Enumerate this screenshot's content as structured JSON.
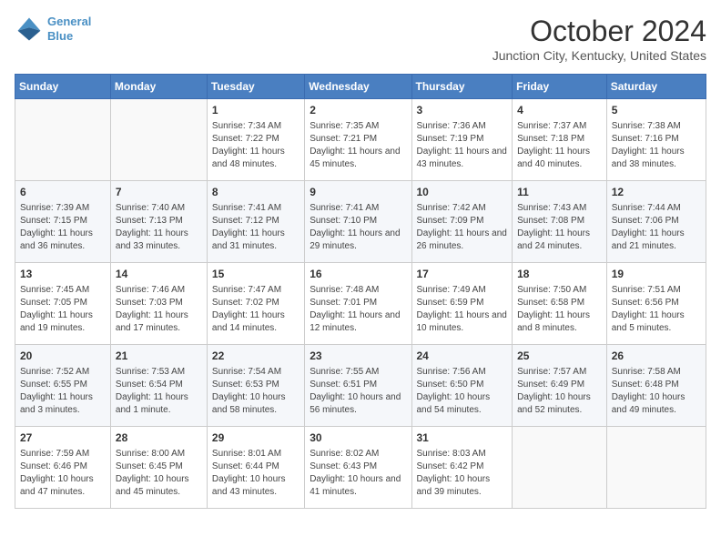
{
  "logo": {
    "line1": "General",
    "line2": "Blue"
  },
  "title": "October 2024",
  "subtitle": "Junction City, Kentucky, United States",
  "days_header": [
    "Sunday",
    "Monday",
    "Tuesday",
    "Wednesday",
    "Thursday",
    "Friday",
    "Saturday"
  ],
  "weeks": [
    [
      {
        "num": "",
        "sunrise": "",
        "sunset": "",
        "daylight": ""
      },
      {
        "num": "",
        "sunrise": "",
        "sunset": "",
        "daylight": ""
      },
      {
        "num": "1",
        "sunrise": "Sunrise: 7:34 AM",
        "sunset": "Sunset: 7:22 PM",
        "daylight": "Daylight: 11 hours and 48 minutes."
      },
      {
        "num": "2",
        "sunrise": "Sunrise: 7:35 AM",
        "sunset": "Sunset: 7:21 PM",
        "daylight": "Daylight: 11 hours and 45 minutes."
      },
      {
        "num": "3",
        "sunrise": "Sunrise: 7:36 AM",
        "sunset": "Sunset: 7:19 PM",
        "daylight": "Daylight: 11 hours and 43 minutes."
      },
      {
        "num": "4",
        "sunrise": "Sunrise: 7:37 AM",
        "sunset": "Sunset: 7:18 PM",
        "daylight": "Daylight: 11 hours and 40 minutes."
      },
      {
        "num": "5",
        "sunrise": "Sunrise: 7:38 AM",
        "sunset": "Sunset: 7:16 PM",
        "daylight": "Daylight: 11 hours and 38 minutes."
      }
    ],
    [
      {
        "num": "6",
        "sunrise": "Sunrise: 7:39 AM",
        "sunset": "Sunset: 7:15 PM",
        "daylight": "Daylight: 11 hours and 36 minutes."
      },
      {
        "num": "7",
        "sunrise": "Sunrise: 7:40 AM",
        "sunset": "Sunset: 7:13 PM",
        "daylight": "Daylight: 11 hours and 33 minutes."
      },
      {
        "num": "8",
        "sunrise": "Sunrise: 7:41 AM",
        "sunset": "Sunset: 7:12 PM",
        "daylight": "Daylight: 11 hours and 31 minutes."
      },
      {
        "num": "9",
        "sunrise": "Sunrise: 7:41 AM",
        "sunset": "Sunset: 7:10 PM",
        "daylight": "Daylight: 11 hours and 29 minutes."
      },
      {
        "num": "10",
        "sunrise": "Sunrise: 7:42 AM",
        "sunset": "Sunset: 7:09 PM",
        "daylight": "Daylight: 11 hours and 26 minutes."
      },
      {
        "num": "11",
        "sunrise": "Sunrise: 7:43 AM",
        "sunset": "Sunset: 7:08 PM",
        "daylight": "Daylight: 11 hours and 24 minutes."
      },
      {
        "num": "12",
        "sunrise": "Sunrise: 7:44 AM",
        "sunset": "Sunset: 7:06 PM",
        "daylight": "Daylight: 11 hours and 21 minutes."
      }
    ],
    [
      {
        "num": "13",
        "sunrise": "Sunrise: 7:45 AM",
        "sunset": "Sunset: 7:05 PM",
        "daylight": "Daylight: 11 hours and 19 minutes."
      },
      {
        "num": "14",
        "sunrise": "Sunrise: 7:46 AM",
        "sunset": "Sunset: 7:03 PM",
        "daylight": "Daylight: 11 hours and 17 minutes."
      },
      {
        "num": "15",
        "sunrise": "Sunrise: 7:47 AM",
        "sunset": "Sunset: 7:02 PM",
        "daylight": "Daylight: 11 hours and 14 minutes."
      },
      {
        "num": "16",
        "sunrise": "Sunrise: 7:48 AM",
        "sunset": "Sunset: 7:01 PM",
        "daylight": "Daylight: 11 hours and 12 minutes."
      },
      {
        "num": "17",
        "sunrise": "Sunrise: 7:49 AM",
        "sunset": "Sunset: 6:59 PM",
        "daylight": "Daylight: 11 hours and 10 minutes."
      },
      {
        "num": "18",
        "sunrise": "Sunrise: 7:50 AM",
        "sunset": "Sunset: 6:58 PM",
        "daylight": "Daylight: 11 hours and 8 minutes."
      },
      {
        "num": "19",
        "sunrise": "Sunrise: 7:51 AM",
        "sunset": "Sunset: 6:56 PM",
        "daylight": "Daylight: 11 hours and 5 minutes."
      }
    ],
    [
      {
        "num": "20",
        "sunrise": "Sunrise: 7:52 AM",
        "sunset": "Sunset: 6:55 PM",
        "daylight": "Daylight: 11 hours and 3 minutes."
      },
      {
        "num": "21",
        "sunrise": "Sunrise: 7:53 AM",
        "sunset": "Sunset: 6:54 PM",
        "daylight": "Daylight: 11 hours and 1 minute."
      },
      {
        "num": "22",
        "sunrise": "Sunrise: 7:54 AM",
        "sunset": "Sunset: 6:53 PM",
        "daylight": "Daylight: 10 hours and 58 minutes."
      },
      {
        "num": "23",
        "sunrise": "Sunrise: 7:55 AM",
        "sunset": "Sunset: 6:51 PM",
        "daylight": "Daylight: 10 hours and 56 minutes."
      },
      {
        "num": "24",
        "sunrise": "Sunrise: 7:56 AM",
        "sunset": "Sunset: 6:50 PM",
        "daylight": "Daylight: 10 hours and 54 minutes."
      },
      {
        "num": "25",
        "sunrise": "Sunrise: 7:57 AM",
        "sunset": "Sunset: 6:49 PM",
        "daylight": "Daylight: 10 hours and 52 minutes."
      },
      {
        "num": "26",
        "sunrise": "Sunrise: 7:58 AM",
        "sunset": "Sunset: 6:48 PM",
        "daylight": "Daylight: 10 hours and 49 minutes."
      }
    ],
    [
      {
        "num": "27",
        "sunrise": "Sunrise: 7:59 AM",
        "sunset": "Sunset: 6:46 PM",
        "daylight": "Daylight: 10 hours and 47 minutes."
      },
      {
        "num": "28",
        "sunrise": "Sunrise: 8:00 AM",
        "sunset": "Sunset: 6:45 PM",
        "daylight": "Daylight: 10 hours and 45 minutes."
      },
      {
        "num": "29",
        "sunrise": "Sunrise: 8:01 AM",
        "sunset": "Sunset: 6:44 PM",
        "daylight": "Daylight: 10 hours and 43 minutes."
      },
      {
        "num": "30",
        "sunrise": "Sunrise: 8:02 AM",
        "sunset": "Sunset: 6:43 PM",
        "daylight": "Daylight: 10 hours and 41 minutes."
      },
      {
        "num": "31",
        "sunrise": "Sunrise: 8:03 AM",
        "sunset": "Sunset: 6:42 PM",
        "daylight": "Daylight: 10 hours and 39 minutes."
      },
      {
        "num": "",
        "sunrise": "",
        "sunset": "",
        "daylight": ""
      },
      {
        "num": "",
        "sunrise": "",
        "sunset": "",
        "daylight": ""
      }
    ]
  ]
}
